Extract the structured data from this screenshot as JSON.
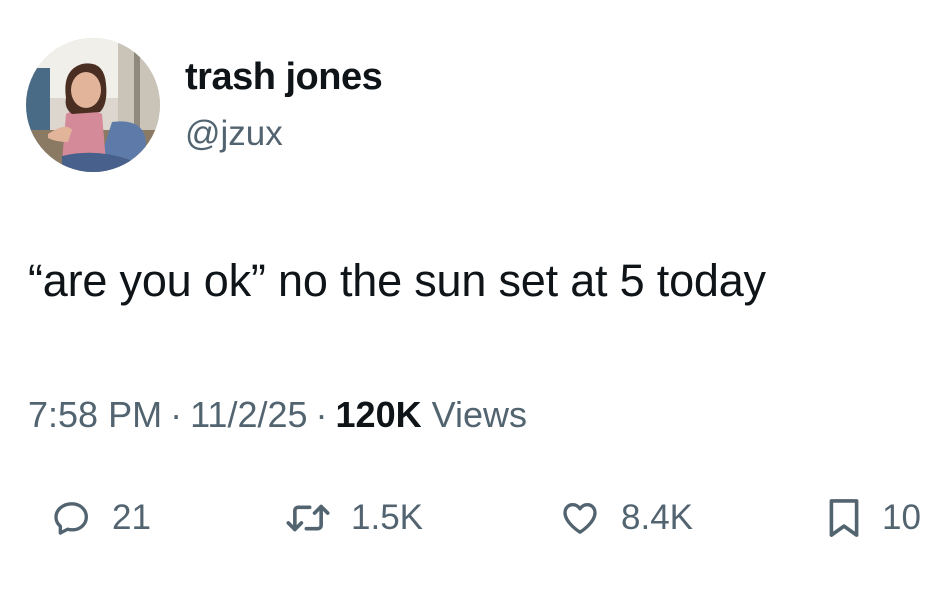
{
  "author": {
    "display_name": "trash jones",
    "handle": "@jzux",
    "avatar_icon": "profile-photo"
  },
  "tweet": {
    "text": "“are you ok” no the sun set at 5 today"
  },
  "meta": {
    "time": "7:58 PM",
    "separator": "·",
    "date": "11/2/25",
    "views_count": "120K",
    "views_label": "Views"
  },
  "actions": {
    "reply": {
      "icon": "reply-icon",
      "count": "21"
    },
    "retweet": {
      "icon": "retweet-icon",
      "count": "1.5K"
    },
    "like": {
      "icon": "heart-icon",
      "count": "8.4K"
    },
    "bookmark": {
      "icon": "bookmark-icon",
      "count": "10"
    }
  },
  "colors": {
    "text_primary": "#0f1419",
    "text_secondary": "#536471",
    "background": "#ffffff"
  }
}
